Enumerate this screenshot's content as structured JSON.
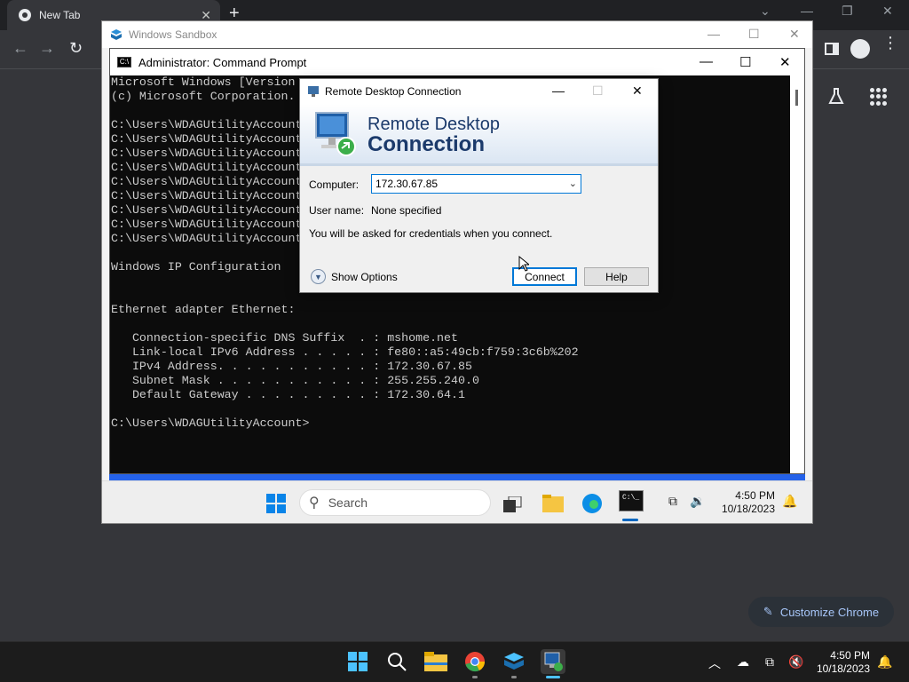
{
  "chrome": {
    "tab_title": "New Tab",
    "customize_label": "Customize Chrome"
  },
  "sandbox": {
    "title": "Windows Sandbox"
  },
  "cmd": {
    "title": "Administrator: Command Prompt",
    "lines": [
      "Microsoft Windows [Version",
      "(c) Microsoft Corporation.",
      "",
      "C:\\Users\\WDAGUtilityAccount",
      "C:\\Users\\WDAGUtilityAccount",
      "C:\\Users\\WDAGUtilityAccount",
      "C:\\Users\\WDAGUtilityAccount",
      "C:\\Users\\WDAGUtilityAccount",
      "C:\\Users\\WDAGUtilityAccount",
      "C:\\Users\\WDAGUtilityAccount",
      "C:\\Users\\WDAGUtilityAccount",
      "C:\\Users\\WDAGUtilityAccount",
      "",
      "Windows IP Configuration",
      "",
      "",
      "Ethernet adapter Ethernet:",
      "",
      "   Connection-specific DNS Suffix  . : mshome.net",
      "   Link-local IPv6 Address . . . . . : fe80::a5:49cb:f759:3c6b%202",
      "   IPv4 Address. . . . . . . . . . . : 172.30.67.85",
      "   Subnet Mask . . . . . . . . . . . : 255.255.240.0",
      "   Default Gateway . . . . . . . . . : 172.30.64.1",
      "",
      "C:\\Users\\WDAGUtilityAccount>"
    ]
  },
  "rdc": {
    "title": "Remote Desktop Connection",
    "banner_line1": "Remote Desktop",
    "banner_line2": "Connection",
    "computer_label": "Computer:",
    "computer_value": "172.30.67.85",
    "username_label": "User name:",
    "username_value": "None specified",
    "info_text": "You will be asked for credentials when you connect.",
    "show_options_label": "Show Options",
    "connect_label": "Connect",
    "help_label": "Help"
  },
  "sandbox_taskbar": {
    "search_placeholder": "Search",
    "time": "4:50 PM",
    "date": "10/18/2023"
  },
  "host_taskbar": {
    "time": "4:50 PM",
    "date": "10/18/2023"
  }
}
